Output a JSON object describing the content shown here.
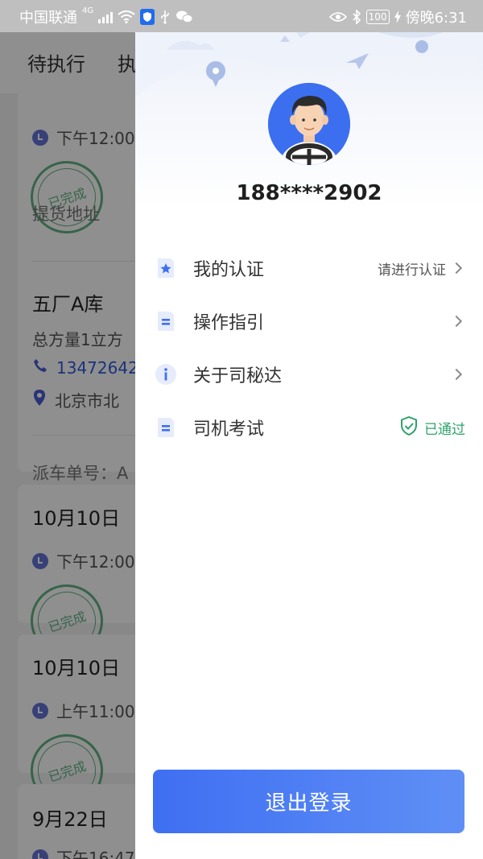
{
  "status_bar": {
    "carrier": "中国联通",
    "network": "4G",
    "battery": "100",
    "time": "傍晚6:31"
  },
  "background": {
    "tabs": [
      {
        "label": "待执行"
      },
      {
        "label": "执"
      }
    ],
    "cards": [
      {
        "time": "下午12:00",
        "stamp": "已完成",
        "pickup_label": "提货地址"
      },
      {
        "warehouse": "五厂A库",
        "volume": "总方量1立方",
        "phone": "13472642",
        "address": "北京市北",
        "dispatch": "派车单号：A"
      },
      {
        "date": "10月10日",
        "time": "下午12:00",
        "stamp": "已完成"
      },
      {
        "date": "10月10日",
        "time": "上午11:00",
        "stamp": "已完成"
      },
      {
        "date": "9月22日",
        "time": "下午16:47"
      }
    ]
  },
  "drawer": {
    "phone_masked": "188****2902",
    "menu": [
      {
        "label": "我的认证",
        "right_text": "请进行认证",
        "icon": "star-doc-icon"
      },
      {
        "label": "操作指引",
        "right_text": "",
        "icon": "doc-icon"
      },
      {
        "label": "关于司秘达",
        "right_text": "",
        "icon": "info-icon"
      },
      {
        "label": "司机考试",
        "right_text": "已通过",
        "icon": "doc-icon"
      }
    ],
    "logout_label": "退出登录"
  },
  "colors": {
    "accent": "#3f6ff2",
    "passed": "#2ea46a",
    "avatar_bg": "#3b6ff0"
  }
}
